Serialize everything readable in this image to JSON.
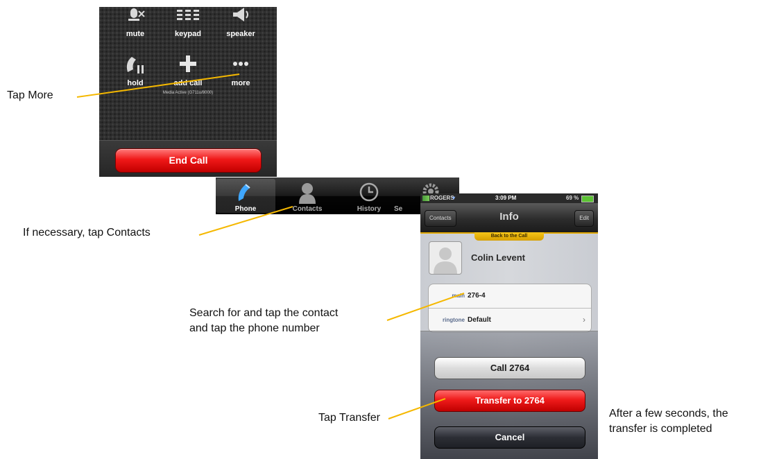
{
  "call_screen": {
    "buttons": [
      {
        "label": "mute",
        "icon": "mute-icon"
      },
      {
        "label": "keypad",
        "icon": "keypad-icon"
      },
      {
        "label": "speaker",
        "icon": "speaker-icon"
      },
      {
        "label": "hold",
        "icon": "hold-icon"
      },
      {
        "label": "add call",
        "icon": "add-icon"
      },
      {
        "label": "more",
        "icon": "more-icon"
      }
    ],
    "media_status": "Media Active (G711u/8000)",
    "end_call_label": "End Call"
  },
  "tab_bar": {
    "tabs": [
      {
        "label": "Phone",
        "icon": "phone-icon",
        "active": true
      },
      {
        "label": "Contacts",
        "icon": "contact-person-icon",
        "active": false
      },
      {
        "label": "History",
        "icon": "clock-icon",
        "active": false
      },
      {
        "label": "Se",
        "icon": "gear-icon",
        "active": false
      }
    ]
  },
  "contact_screen": {
    "status_bar": {
      "carrier": "ROGERS",
      "time": "3:09 PM",
      "battery": "69 %"
    },
    "nav": {
      "back_label": "Contacts",
      "title": "Info",
      "edit_label": "Edit"
    },
    "back_to_call": "Back to the Call",
    "contact_name": "Colin Levent",
    "fields": [
      {
        "key": "main",
        "value": "276-4"
      },
      {
        "key": "ringtone",
        "value": "Default"
      }
    ],
    "action_sheet": {
      "call_label": "Call 2764",
      "transfer_label": "Transfer to 2764",
      "cancel_label": "Cancel"
    }
  },
  "captions": {
    "tap_more": "Tap More",
    "tap_contacts": "If necessary, tap Contacts",
    "search_line1": "Search for and tap the contact",
    "search_line2": "and tap the phone number",
    "tap_transfer": "Tap Transfer",
    "completed_line1": "After a few seconds, the",
    "completed_line2": "transfer is completed"
  },
  "colors": {
    "callout_line": "#f5b800",
    "end_call": "#e81010",
    "accent_gold": "#e1a800"
  }
}
